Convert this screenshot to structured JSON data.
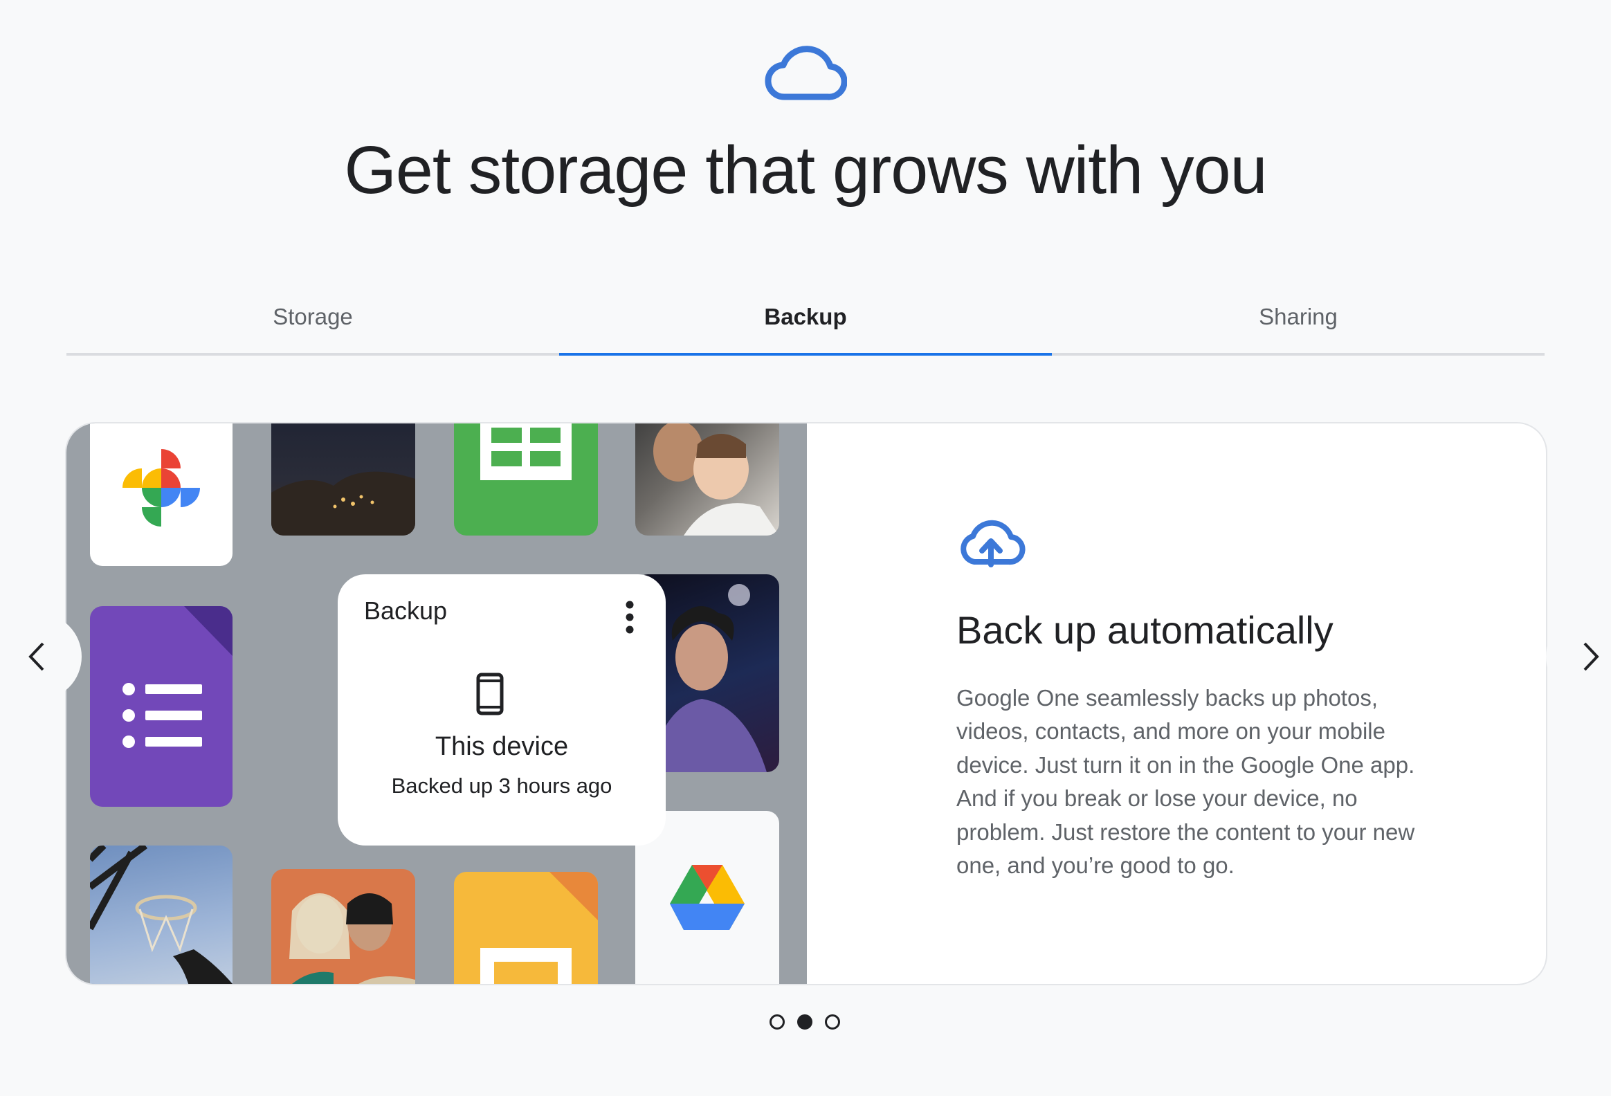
{
  "hero": {
    "icon": "cloud-icon",
    "headline": "Get storage that grows with you"
  },
  "tabs": [
    {
      "label": "Storage",
      "active": false
    },
    {
      "label": "Backup",
      "active": true
    },
    {
      "label": "Sharing",
      "active": false
    }
  ],
  "backup_card": {
    "title": "Backup",
    "menu_icon": "more-vert-icon",
    "device_icon": "phone-icon",
    "device_name": "This device",
    "status": "Backed up 3 hours ago"
  },
  "feature": {
    "icon": "cloud-upload-icon",
    "title": "Back up automatically",
    "body": "Google One seamlessly backs up photos, videos, contacts, and more on your mobile device. Just turn it on in the Google One app. And if you break or lose your device, no problem. Just restore the content to your new one, and you’re good to go."
  },
  "carousel": {
    "prev_icon": "chevron-left-icon",
    "next_icon": "chevron-right-icon",
    "slide_count": 3,
    "active_slide": 2
  },
  "colors": {
    "accent": "#1a73e8",
    "cloud_icon": "#3c78d8",
    "forms_purple": "#7248b9",
    "sheets_green": "#4caf50",
    "slides_yellow": "#f6b93b",
    "mosaic_bg": "#9aa0a6"
  }
}
